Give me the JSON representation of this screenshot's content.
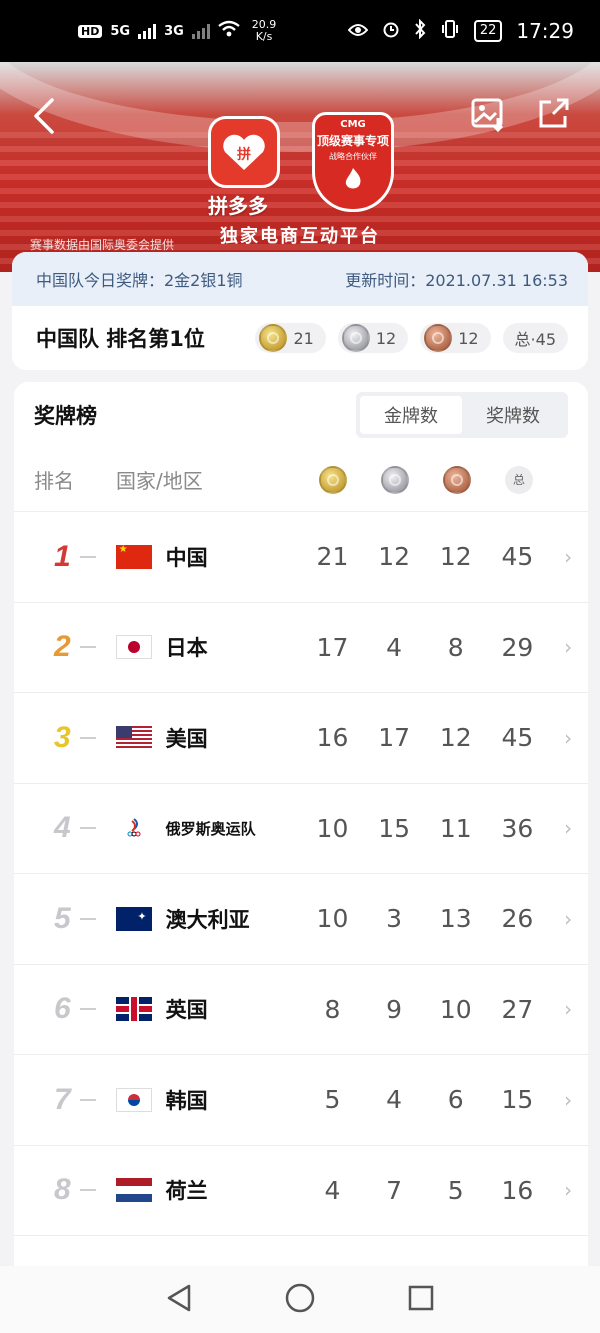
{
  "status_bar": {
    "hd": "HD",
    "sim1": "5G",
    "sim2": "3G",
    "speed_value": "20.9",
    "speed_unit": "K/s",
    "battery": "22",
    "time": "17:29"
  },
  "banner": {
    "brand_name": "拼多多",
    "platform_text": "独家电商互动平台",
    "cmg_tag": "CMG",
    "cmg_title": "顶级赛事专项",
    "cmg_subtitle": "战略合作伙伴",
    "data_source": "赛事数据由国际奥委会提供"
  },
  "info": {
    "today_medals": "中国队今日奖牌：2金2银1铜",
    "update_time": "更新时间：2021.07.31 16:53",
    "team_rank": "中国队 排名第1位",
    "gold": "21",
    "silver": "12",
    "bronze": "12",
    "total": "总·45"
  },
  "table": {
    "title": "奖牌榜",
    "tabs": [
      "金牌数",
      "奖牌数"
    ],
    "col_rank": "排名",
    "col_country": "国家/地区",
    "col_total": "总",
    "rows": [
      {
        "rank": "1",
        "country": "中国",
        "gold": "21",
        "silver": "12",
        "bronze": "12",
        "total": "45"
      },
      {
        "rank": "2",
        "country": "日本",
        "gold": "17",
        "silver": "4",
        "bronze": "8",
        "total": "29"
      },
      {
        "rank": "3",
        "country": "美国",
        "gold": "16",
        "silver": "17",
        "bronze": "12",
        "total": "45"
      },
      {
        "rank": "4",
        "country": "俄罗斯奥运队",
        "gold": "10",
        "silver": "15",
        "bronze": "11",
        "total": "36"
      },
      {
        "rank": "5",
        "country": "澳大利亚",
        "gold": "10",
        "silver": "3",
        "bronze": "13",
        "total": "26"
      },
      {
        "rank": "6",
        "country": "英国",
        "gold": "8",
        "silver": "9",
        "bronze": "10",
        "total": "27"
      },
      {
        "rank": "7",
        "country": "韩国",
        "gold": "5",
        "silver": "4",
        "bronze": "6",
        "total": "15"
      },
      {
        "rank": "8",
        "country": "荷兰",
        "gold": "4",
        "silver": "7",
        "bronze": "5",
        "total": "16"
      }
    ]
  },
  "icons": {
    "back": "back-arrow-icon",
    "image": "image-download-icon",
    "share": "share-icon",
    "nav_back": "triangle-back-icon",
    "nav_home": "circle-home-icon",
    "nav_recent": "square-recent-icon"
  },
  "colors": {
    "banner_red": "#d2302a",
    "rank1": "#d23a36",
    "rank2": "#e69a35",
    "rank3": "#e8c52a",
    "info_bg": "#e9eff8"
  }
}
